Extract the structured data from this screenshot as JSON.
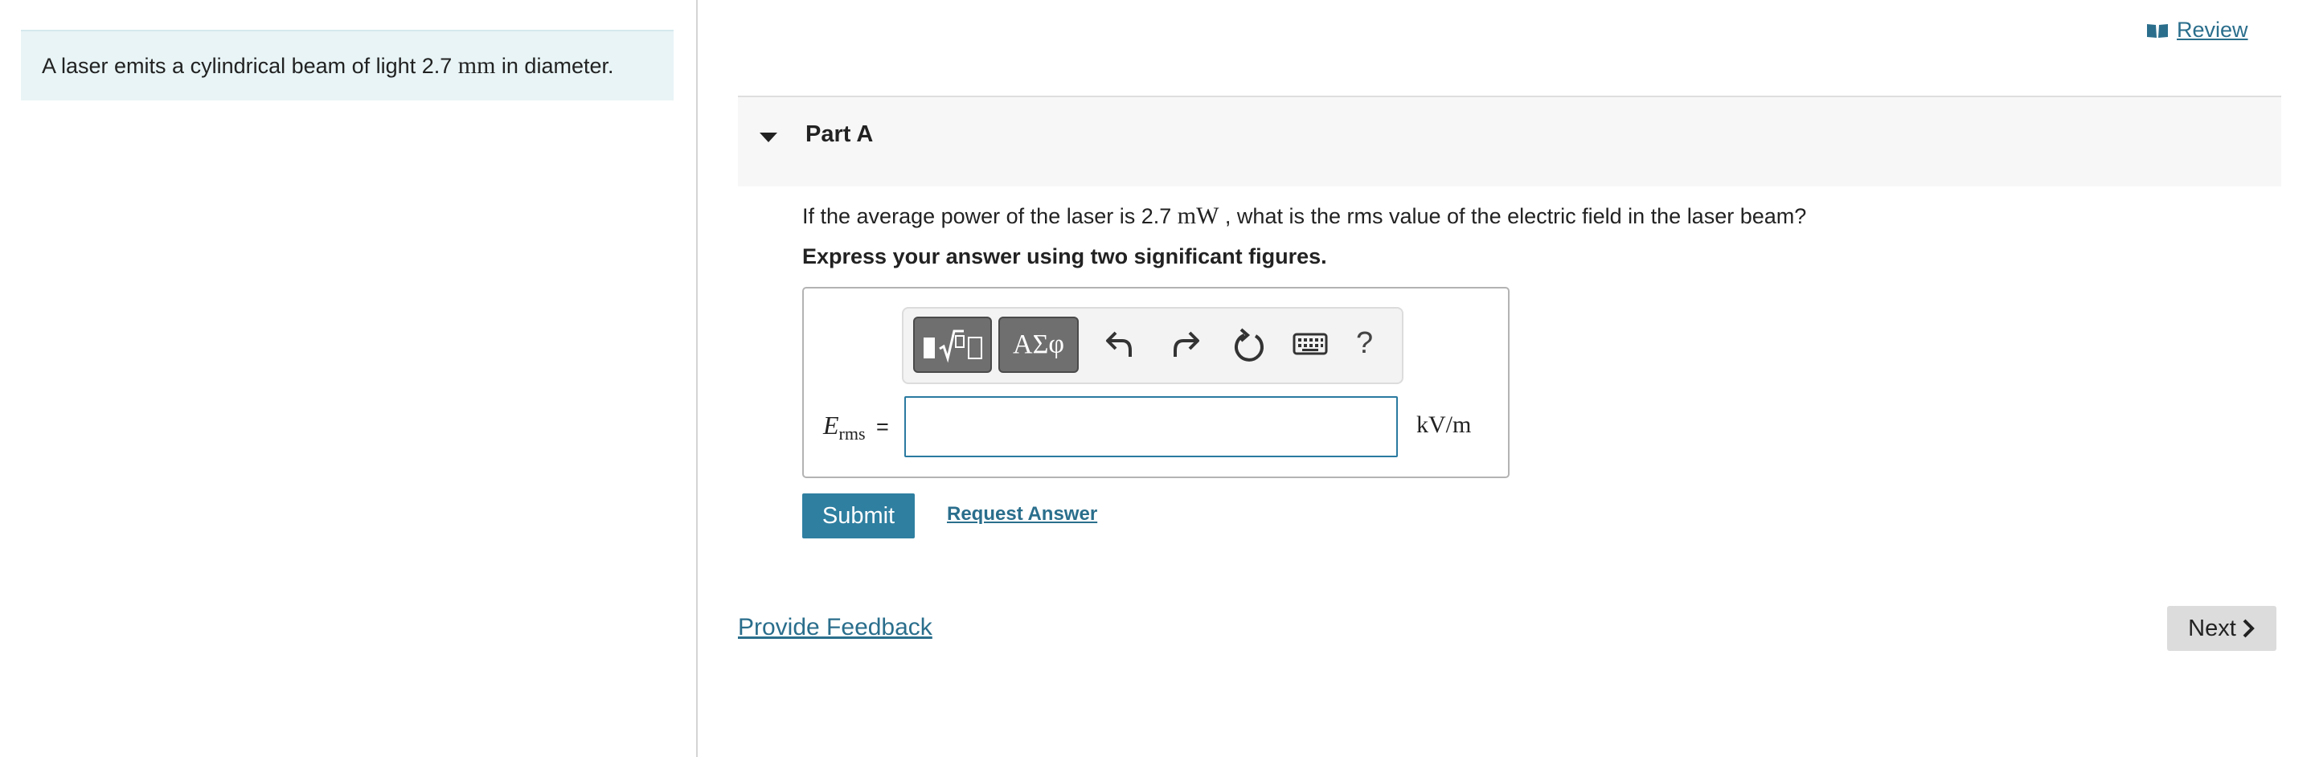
{
  "intro": {
    "text_before": "A laser emits a cylindrical beam of light 2.7 ",
    "unit": "mm",
    "text_after": " in diameter."
  },
  "review": {
    "label": "Review",
    "icon": "book-icon"
  },
  "part": {
    "title": "Part A",
    "expanded": true
  },
  "question": {
    "text_before": "If the average power of the laser is 2.7 ",
    "unit": "mW",
    "text_after": " , what is the rms value of the electric field in the laser beam?"
  },
  "instruction": "Express your answer using two significant figures.",
  "answer": {
    "variable": "E",
    "subscript": "rms",
    "equals": "=",
    "value": "",
    "unit": "kV/m"
  },
  "toolbar": {
    "templates_label": "templates",
    "symbols_label": "ΑΣφ",
    "help_label": "?"
  },
  "actions": {
    "submit_label": "Submit",
    "request_answer_label": "Request Answer",
    "feedback_label": "Provide Feedback",
    "next_label": "Next"
  },
  "colors": {
    "accent": "#2f7fa0",
    "link": "#2a6e8c",
    "intro_bg": "#e8f4f6",
    "part_header_bg": "#f7f7f7",
    "next_bg": "#dcdcdc"
  }
}
